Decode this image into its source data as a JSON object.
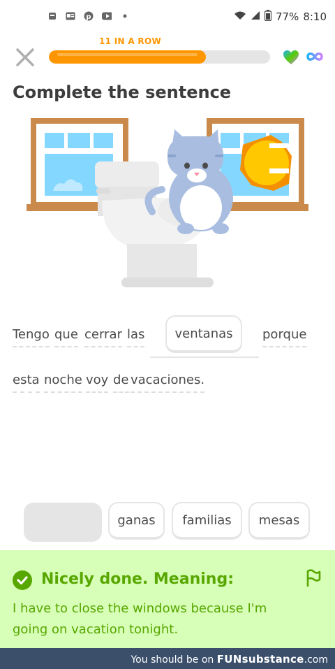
{
  "status_bar": {
    "battery": "77%",
    "time": "8:10"
  },
  "streak_label": "11 IN A ROW",
  "progress": {
    "fraction": 0.71
  },
  "icons": {
    "close": "close-icon",
    "heart": "heart-icon",
    "infinity": "infinity-icon",
    "check": "check-circle-icon",
    "flag": "flag-icon"
  },
  "title": "Complete the sentence",
  "sentence": {
    "line1": [
      "Tengo",
      "que",
      "cerrar",
      "las"
    ],
    "selected_answer": "ventanas",
    "line1_end": "porque",
    "line2": [
      "esta",
      "noche",
      "voy",
      "de",
      "vacaciones."
    ]
  },
  "word_bank": [
    "ganas",
    "familias",
    "mesas"
  ],
  "feedback": {
    "title": "Nicely done. Meaning:",
    "text": "I have to close the windows because I'm going on vacation tonight."
  },
  "banner": {
    "prefix": "You should be on ",
    "brand": "FUNsubstance",
    "suffix": ".com"
  },
  "colors": {
    "accent": "#ff9600",
    "success": "#58a700",
    "success_bg": "#d7ffb8",
    "banner_bg": "#3b4f6b"
  }
}
